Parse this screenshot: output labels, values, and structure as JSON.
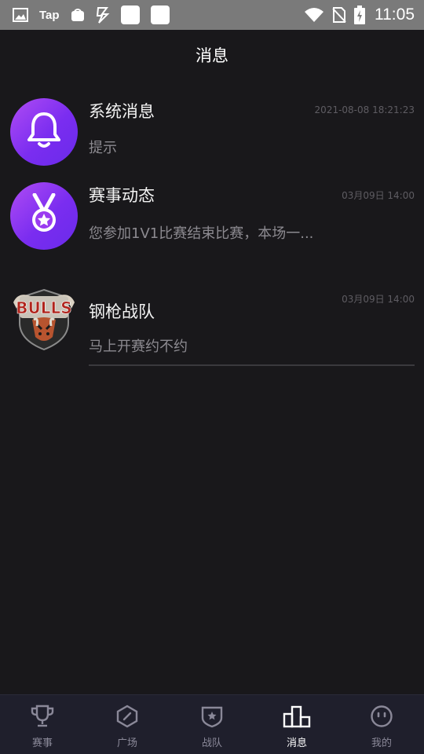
{
  "status_bar": {
    "tap_label": "Tap",
    "time": "11:05"
  },
  "header": {
    "title": "消息"
  },
  "messages": [
    {
      "title": "系统消息",
      "time": "2021-08-08 18:21:23",
      "preview": "提示",
      "icon": "bell-icon"
    },
    {
      "title": "赛事动态",
      "time": "03月09日 14:00",
      "preview": "您参加1V1比赛结束比赛，本场一...",
      "icon": "medal-icon"
    },
    {
      "title": "钢枪战队",
      "time": "03月09日 14:00",
      "preview": "马上开赛约不约",
      "icon": "bulls-logo"
    }
  ],
  "bottom_nav": {
    "tabs": [
      {
        "label": "赛事",
        "icon": "trophy-icon",
        "active": false
      },
      {
        "label": "广场",
        "icon": "plaza-icon",
        "active": false
      },
      {
        "label": "战队",
        "icon": "team-shield-icon",
        "active": false
      },
      {
        "label": "消息",
        "icon": "podium-icon",
        "active": true
      },
      {
        "label": "我的",
        "icon": "profile-face-icon",
        "active": false
      }
    ]
  },
  "colors": {
    "background": "#19181b",
    "accent_purple": "#7a2df0",
    "bottom_nav_bg": "#1f1f2c",
    "inactive_tab": "#8a8898"
  }
}
